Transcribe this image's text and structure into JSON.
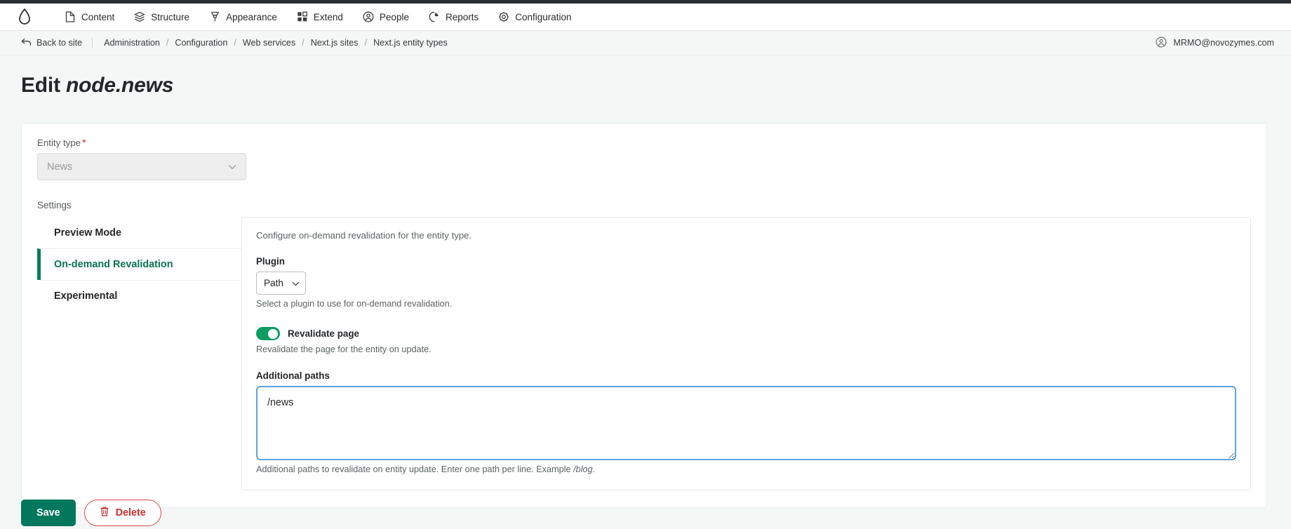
{
  "toolbar": {
    "logo_icon": "drupal-drop-icon",
    "items": [
      {
        "label": "Content",
        "icon": "file-icon"
      },
      {
        "label": "Structure",
        "icon": "layers-icon"
      },
      {
        "label": "Appearance",
        "icon": "paint-brush-icon"
      },
      {
        "label": "Extend",
        "icon": "blocks-icon"
      },
      {
        "label": "People",
        "icon": "user-circle-icon"
      },
      {
        "label": "Reports",
        "icon": "pie-chart-icon"
      },
      {
        "label": "Configuration",
        "icon": "gear-icon"
      }
    ]
  },
  "breadcrumb": {
    "back_to_site": "Back to site",
    "back_icon": "arrow-back-icon",
    "items": [
      "Administration",
      "Configuration",
      "Web services",
      "Next.js sites",
      "Next.js entity types"
    ],
    "separator": "/"
  },
  "account": {
    "icon": "user-circle-icon",
    "email": "MRMO@novozymes.com"
  },
  "page": {
    "title_prefix": "Edit",
    "title_emphasis": "node.news"
  },
  "form": {
    "entity_type": {
      "label": "Entity type",
      "required_marker": "*",
      "value": "News",
      "disabled": true,
      "chevron_icon": "chevron-down-icon"
    },
    "settings_heading": "Settings",
    "tabs": [
      {
        "label": "Preview Mode",
        "active": false
      },
      {
        "label": "On-demand Revalidation",
        "active": true
      },
      {
        "label": "Experimental",
        "active": false
      }
    ],
    "pane": {
      "description": "Configure on-demand revalidation for the entity type.",
      "plugin": {
        "label": "Plugin",
        "value": "Path",
        "chevron_icon": "chevron-down-icon",
        "help": "Select a plugin to use for on-demand revalidation."
      },
      "revalidate_page": {
        "label": "Revalidate page",
        "checked": true,
        "help": "Revalidate the page for the entity on update."
      },
      "additional_paths": {
        "label": "Additional paths",
        "value": "/news",
        "placeholder": "",
        "help_plain": "Additional paths to revalidate on entity update. Enter one path per line. Example ",
        "help_example": "/blog",
        "help_end": "."
      }
    }
  },
  "actions": {
    "save_label": "Save",
    "delete_label": "Delete",
    "delete_icon": "trash-icon"
  },
  "colors": {
    "accent_green": "#01785c",
    "toggle_green": "#0d9c62",
    "active_tab_green": "#0a7352",
    "delete_red": "#d02d2d",
    "required_red": "#d72222",
    "focus_blue": "#5ba4e0",
    "page_bg": "#f3f7f6",
    "top_strip": "#2c2f31"
  }
}
